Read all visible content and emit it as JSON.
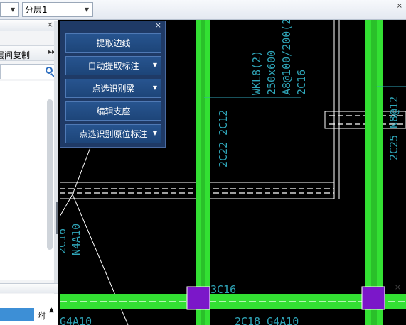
{
  "toolbar": {
    "combo1_value": "",
    "layer_combo_value": "分层1",
    "close_label": "×"
  },
  "left_panel": {
    "close_label": "×",
    "copy_label": "层间复制",
    "more_label": "▸▸",
    "bottom_close_label": "×",
    "table_column": "附"
  },
  "float_panel": {
    "close_label": "×",
    "buttons": [
      {
        "label": "提取边线",
        "dropdown": false
      },
      {
        "label": "自动提取标注",
        "dropdown": true
      },
      {
        "label": "点选识别梁",
        "dropdown": true
      },
      {
        "label": "编辑支座",
        "dropdown": false
      },
      {
        "label": "点选识别原位标注",
        "dropdown": true
      }
    ]
  },
  "cad_labels": {
    "beam_name": "WKL8(2)",
    "beam_size": "250x600",
    "stirrup": "A8@100/200(2)",
    "top_bar": "2C16",
    "side_left": "2C22 2C12",
    "side_right": "2C25 N8@12",
    "left_text1": "2C16",
    "left_text2": "N4A10",
    "node_text": "3C16",
    "bottom_text1": "G4A10",
    "bottom_text2": "2C18 G4A10"
  },
  "colors": {
    "canvas": "#000000",
    "beam_green": "#33e033",
    "column_purple": "#7b17c9",
    "annotation_cyan": "#2fa5b8",
    "panel_blue": "#1f3a66"
  }
}
